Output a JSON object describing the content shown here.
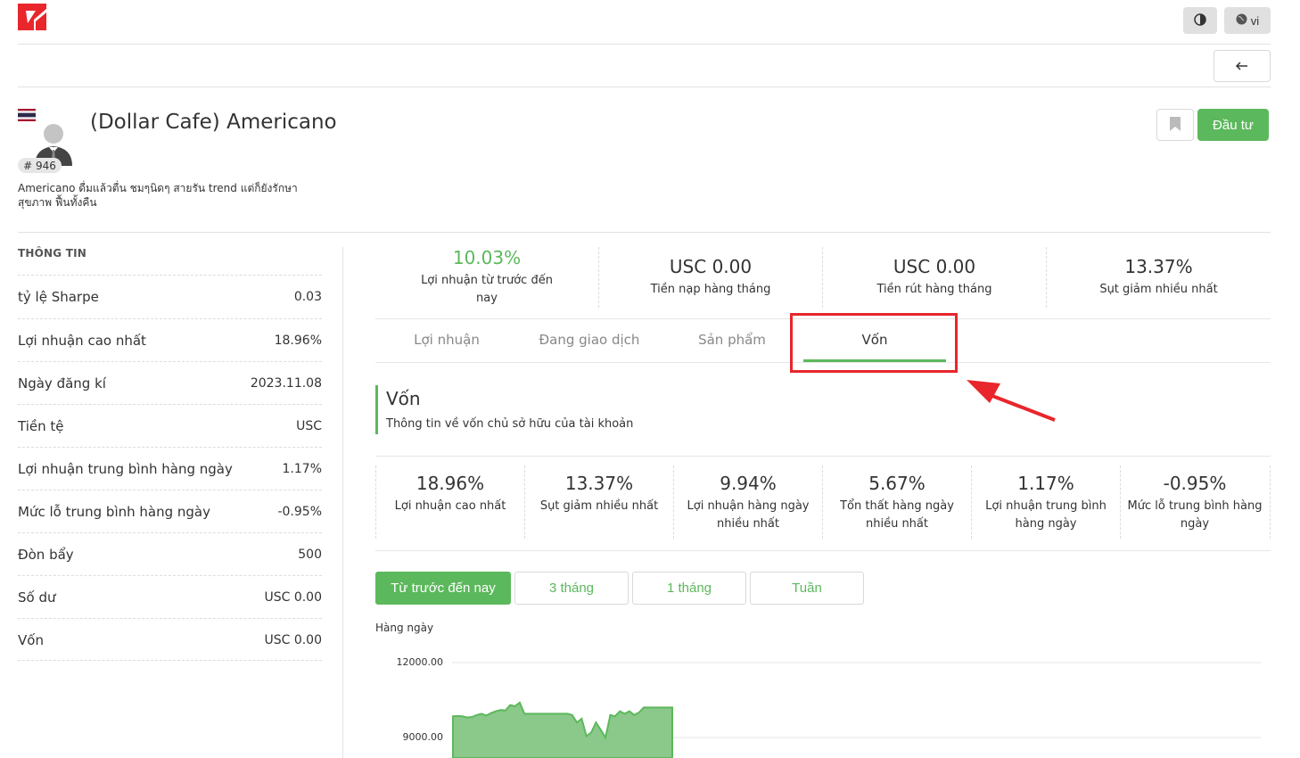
{
  "header": {
    "theme_icon": "half-circle-icon",
    "lang_label": "vi",
    "brand_color": "#e8262c"
  },
  "profile": {
    "title": "(Dollar Cafe) Americano",
    "rank": "# 946",
    "description": "Americano ดื่มแล้วตื่น ชมๆนิดๆ สายรัน trend แต่ก็ยังรักษาสุขภาพ ฟื้นทั้งคืน",
    "invest_label": "Đầu tư",
    "accent": "#5cb85c"
  },
  "info": {
    "heading": "THÔNG TIN",
    "rows": [
      {
        "label": "tỷ lệ Sharpe",
        "value": "0.03"
      },
      {
        "label": "Lợi nhuận cao nhất",
        "value": "18.96%"
      },
      {
        "label": "Ngày đăng kí",
        "value": "2023.11.08"
      },
      {
        "label": "Tiền tệ",
        "value": "USC"
      },
      {
        "label": "Lợi nhuận trung bình hàng ngày",
        "value": "1.17%"
      },
      {
        "label": "Mức lỗ trung bình hàng ngày",
        "value": "-0.95%"
      },
      {
        "label": "Đòn bẩy",
        "value": "500"
      },
      {
        "label": "Số dư",
        "value": "USC 0.00"
      },
      {
        "label": "Vốn",
        "value": "USC 0.00"
      }
    ]
  },
  "stats": [
    {
      "value": "10.03%",
      "label": "Lợi nhuận từ trước đến nay"
    },
    {
      "value": "USC 0.00",
      "label": "Tiền nạp hàng tháng"
    },
    {
      "value": "USC 0.00",
      "label": "Tiền rút hàng tháng"
    },
    {
      "value": "13.37%",
      "label": "Sụt giảm nhiều nhất"
    }
  ],
  "tabs": [
    {
      "label": "Lợi nhuận"
    },
    {
      "label": "Đang giao dịch"
    },
    {
      "label": "Sản phẩm"
    },
    {
      "label": "Vốn"
    }
  ],
  "section": {
    "title": "Vốn",
    "subtitle": "Thông tin về vốn chủ sở hữu của tài khoản"
  },
  "metrics": [
    {
      "value": "18.96%",
      "label": "Lợi nhuận cao nhất"
    },
    {
      "value": "13.37%",
      "label": "Sụt giảm nhiều nhất"
    },
    {
      "value": "9.94%",
      "label": "Lợi nhuận hàng ngày nhiều nhất"
    },
    {
      "value": "5.67%",
      "label": "Tổn thất hàng ngày nhiều nhất"
    },
    {
      "value": "1.17%",
      "label": "Lợi nhuận trung bình hàng ngày"
    },
    {
      "value": "-0.95%",
      "label": "Mức lỗ trung bình hàng ngày"
    }
  ],
  "periods": [
    {
      "label": "Từ trước đến nay"
    },
    {
      "label": "3 tháng"
    },
    {
      "label": "1 tháng"
    },
    {
      "label": "Tuần"
    }
  ],
  "chart_data": {
    "type": "area",
    "ylabel": "Hàng ngày",
    "y_ticks": [
      "12000.00",
      "9000.00"
    ],
    "series": [
      {
        "values": [
          9850,
          9860,
          9850,
          9800,
          9820,
          9900,
          9950,
          9880,
          9980,
          10050,
          10100,
          10080,
          10300,
          10250,
          10400,
          9950,
          9950,
          9950,
          9950,
          9950,
          9950,
          9950,
          9950,
          9950,
          9950,
          9900,
          9600,
          9750,
          9050,
          9200,
          9600,
          9300,
          9000,
          9900,
          9850,
          10050,
          9950,
          10050,
          9900,
          10000,
          10200,
          10200,
          10200,
          10200,
          10200,
          10200,
          10200
        ]
      }
    ],
    "color": "#5cb85c"
  }
}
